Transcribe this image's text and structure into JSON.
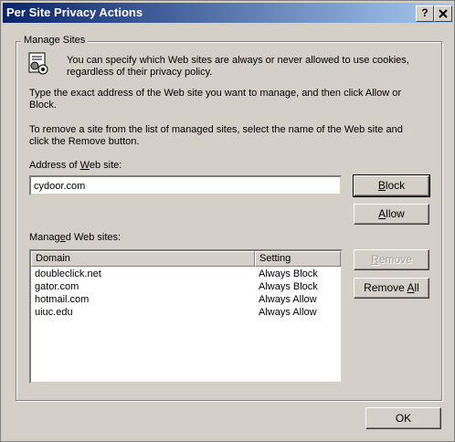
{
  "window": {
    "title": "Per Site Privacy Actions",
    "help_button": "?",
    "close_button": "X"
  },
  "group": {
    "label": "Manage Sites"
  },
  "text": {
    "intro_line1": "You can specify which Web sites are always or never allowed to use cookies,",
    "intro_line2": "regardless of their privacy policy.",
    "instr1_line1": "Type the exact address of the Web site you want to manage, and then click Allow or",
    "instr1_line2": "Block.",
    "instr2_line1": "To remove a site from the list of managed sites, select the name of the Web site and",
    "instr2_line2": "click the Remove button."
  },
  "address": {
    "label_pre": "Address of ",
    "label_key": "W",
    "label_post": "eb site:",
    "value": "cydoor.com"
  },
  "buttons": {
    "block": {
      "key": "B",
      "rest": "lock"
    },
    "allow": {
      "key": "A",
      "rest": "llow"
    },
    "remove": {
      "key": "R",
      "rest": "emove"
    },
    "remove_all": {
      "pre": "Remove ",
      "key": "A",
      "rest": "ll"
    },
    "ok": "OK"
  },
  "managed": {
    "label_pre": "Manag",
    "label_key": "e",
    "label_post": "d Web sites:",
    "columns": [
      "Domain",
      "Setting"
    ],
    "rows": [
      {
        "domain": "doubleclick.net",
        "setting": "Always Block"
      },
      {
        "domain": "gator.com",
        "setting": "Always Block"
      },
      {
        "domain": "hotmail.com",
        "setting": "Always Allow"
      },
      {
        "domain": "uiuc.edu",
        "setting": "Always Allow"
      }
    ]
  }
}
